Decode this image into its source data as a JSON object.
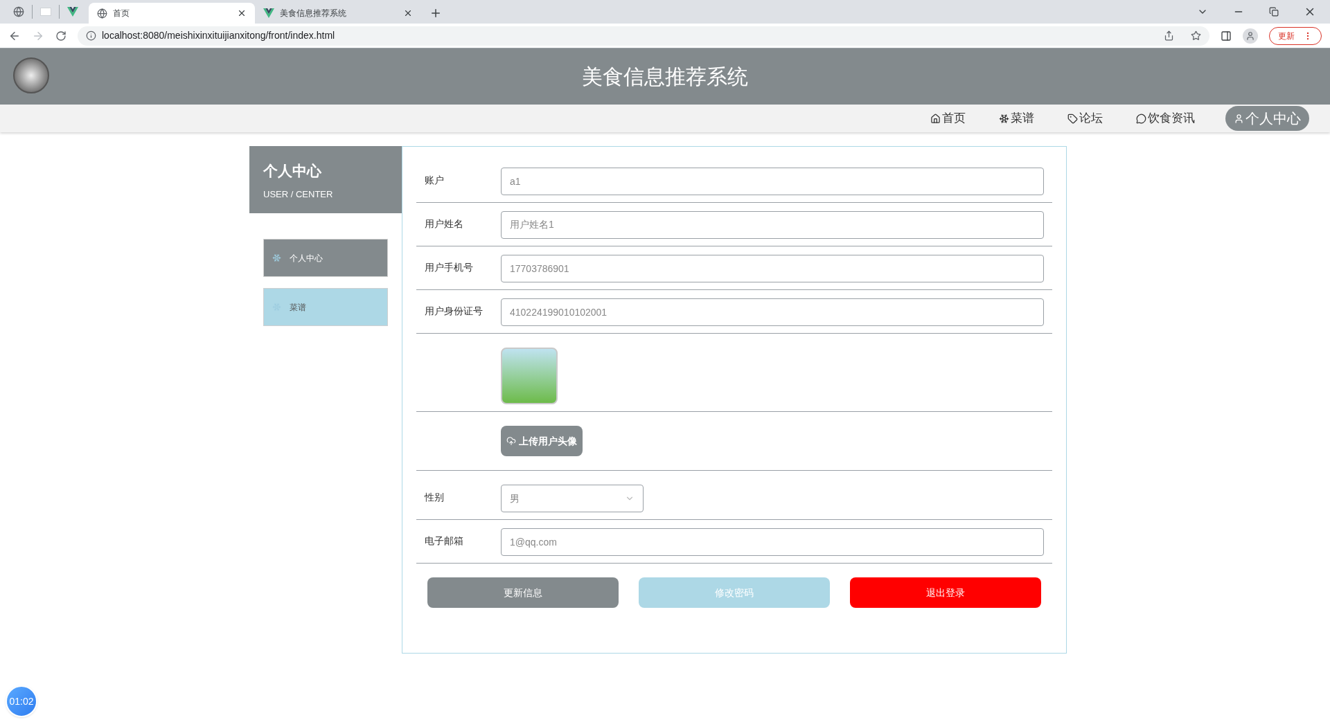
{
  "browser": {
    "tabs": [
      {
        "title": "首页",
        "selected": true,
        "kind": "globe"
      },
      {
        "title": "美食信息推荐系统",
        "selected": false,
        "kind": "vue"
      }
    ],
    "address": "localhost:8080/meishixinxituijianxitong/front/index.html",
    "update_label": "更新"
  },
  "header": {
    "title": "美食信息推荐系统"
  },
  "nav": [
    {
      "label": "首页",
      "selected": false,
      "kind": "home"
    },
    {
      "label": "菜谱",
      "selected": false,
      "kind": "snow"
    },
    {
      "label": "论坛",
      "selected": false,
      "kind": "tag"
    },
    {
      "label": "饮食资讯",
      "selected": false,
      "kind": "chat"
    },
    {
      "label": "个人中心",
      "selected": true,
      "kind": "user"
    }
  ],
  "sidebar": {
    "title": "个人中心",
    "subtitle": "USER / CENTER",
    "items": [
      {
        "label": "个人中心",
        "selected": true
      },
      {
        "label": "菜谱",
        "selected": false
      }
    ]
  },
  "form": [
    {
      "kind": "text",
      "label": "账户",
      "value": "a1"
    },
    {
      "kind": "text",
      "label": "用户姓名",
      "value": "用户姓名1"
    },
    {
      "kind": "text",
      "label": "用户手机号",
      "value": "17703786901"
    },
    {
      "kind": "text",
      "label": "用户身份证号",
      "value": "410224199010102001"
    },
    {
      "kind": "image"
    },
    {
      "kind": "upload",
      "button": "上传用户头像"
    },
    {
      "kind": "select",
      "label": "性别",
      "value": "男"
    },
    {
      "kind": "text",
      "label": "电子邮箱",
      "value": "1@qq.com"
    }
  ],
  "actions": [
    {
      "label": "更新信息",
      "kind": "primary"
    },
    {
      "label": "修改密码",
      "kind": "secondary"
    },
    {
      "label": "退出登录",
      "kind": "danger"
    }
  ],
  "timer": "01:02"
}
